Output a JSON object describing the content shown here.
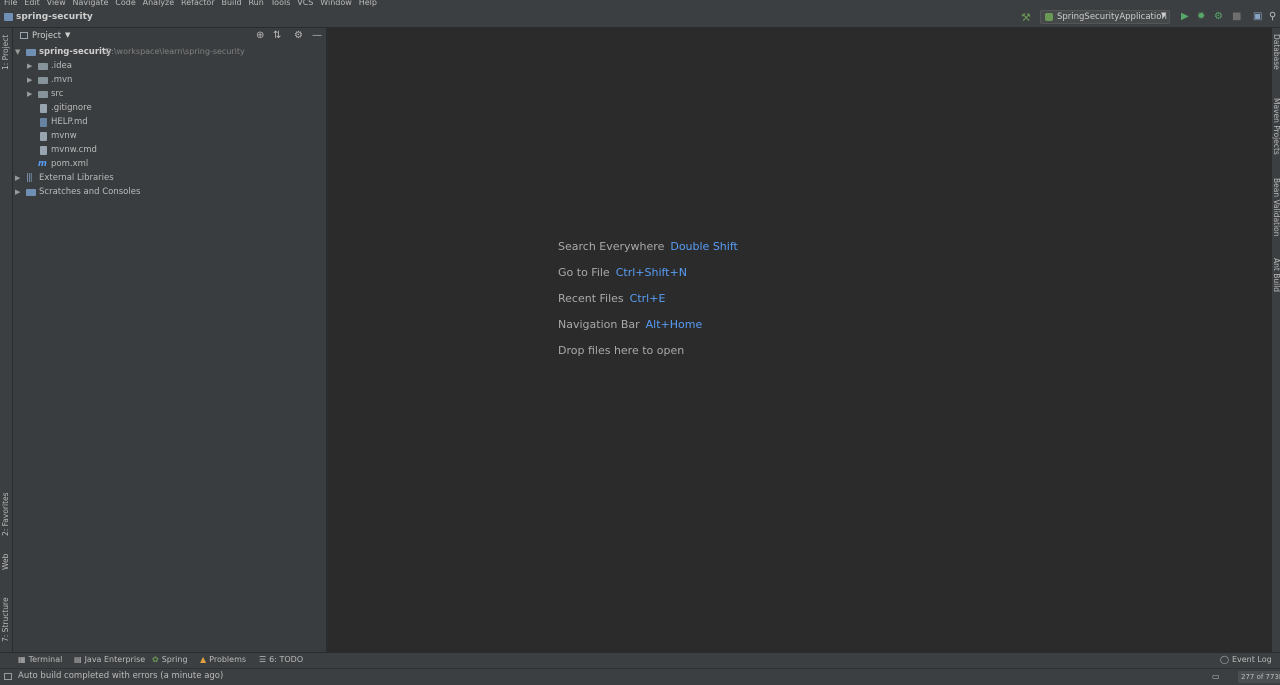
{
  "menu": [
    "File",
    "Edit",
    "View",
    "Navigate",
    "Code",
    "Analyze",
    "Refactor",
    "Build",
    "Run",
    "Tools",
    "VCS",
    "Window",
    "Help"
  ],
  "nav": {
    "project_name": "spring-security",
    "run_config": "SpringSecurityApplication"
  },
  "project_panel": {
    "title": "Project",
    "root_name": "spring-security",
    "root_path": "D:\\workspace\\learn\\spring-security",
    "items": [
      {
        "label": ".idea",
        "kind": "folder"
      },
      {
        "label": ".mvn",
        "kind": "folder"
      },
      {
        "label": "src",
        "kind": "folder"
      },
      {
        "label": ".gitignore",
        "kind": "file"
      },
      {
        "label": "HELP.md",
        "kind": "file"
      },
      {
        "label": "mvnw",
        "kind": "file"
      },
      {
        "label": "mvnw.cmd",
        "kind": "file"
      },
      {
        "label": "pom.xml",
        "kind": "maven"
      }
    ],
    "external_libraries": "External Libraries",
    "scratches": "Scratches and Consoles"
  },
  "left_tabs": {
    "project": "1: Project",
    "favorites": "2: Favorites",
    "web": "Web",
    "structure": "7: Structure"
  },
  "right_tabs": {
    "database": "Database",
    "maven": "Maven Projects",
    "bean": "Bean Validation",
    "ant": "Ant Build"
  },
  "editor_hints": [
    {
      "text": "Search Everywhere",
      "key": "Double Shift"
    },
    {
      "text": "Go to File",
      "key": "Ctrl+Shift+N"
    },
    {
      "text": "Recent Files",
      "key": "Ctrl+E"
    },
    {
      "text": "Navigation Bar",
      "key": "Alt+Home"
    },
    {
      "text": "Drop files here to open",
      "key": ""
    }
  ],
  "bottom_tabs": {
    "terminal": "Terminal",
    "java_enterprise": "Java Enterprise",
    "spring": "Spring",
    "problems": "Problems",
    "todo": "6: TODO",
    "event_log": "Event Log"
  },
  "status": {
    "message": "Auto build completed with errors (a minute ago)",
    "memory": "277 of 773M"
  }
}
